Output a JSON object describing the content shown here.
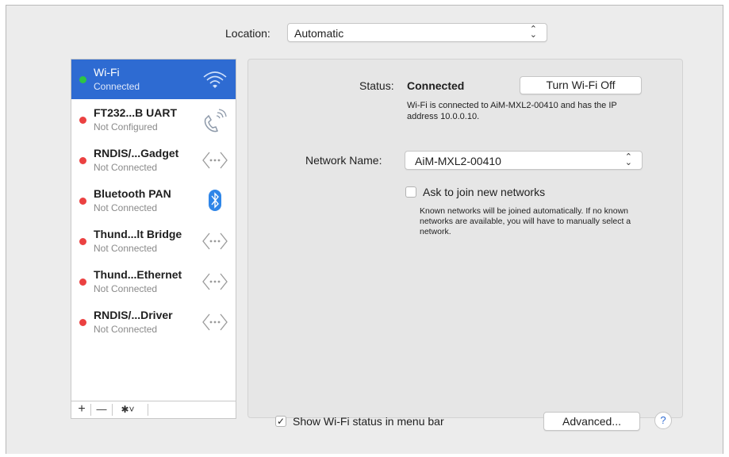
{
  "location": {
    "label": "Location:",
    "value": "Automatic"
  },
  "services": [
    {
      "name": "Wi-Fi",
      "status": "Connected",
      "state": "connected",
      "icon": "wifi-icon",
      "selected": true
    },
    {
      "name": "FT232...B UART",
      "status": "Not Configured",
      "state": "inactive",
      "icon": "phone-icon"
    },
    {
      "name": "RNDIS/...Gadget",
      "status": "Not Connected",
      "state": "inactive",
      "icon": "ethernet-arrows-icon"
    },
    {
      "name": "Bluetooth PAN",
      "status": "Not Connected",
      "state": "inactive",
      "icon": "bluetooth-icon"
    },
    {
      "name": "Thund...lt Bridge",
      "status": "Not Connected",
      "state": "inactive",
      "icon": "ethernet-arrows-icon"
    },
    {
      "name": "Thund...Ethernet",
      "status": "Not Connected",
      "state": "inactive",
      "icon": "ethernet-arrows-icon"
    },
    {
      "name": "RNDIS/...Driver",
      "status": "Not Connected",
      "state": "inactive",
      "icon": "ethernet-arrows-icon"
    }
  ],
  "sidebar_buttons": {
    "add": "+",
    "remove": "—",
    "action": "✱˅"
  },
  "status": {
    "label": "Status:",
    "value": "Connected",
    "toggle_button": "Turn Wi-Fi Off",
    "description": "Wi-Fi is connected to AiM-MXL2-00410 and has the IP address 10.0.0.10."
  },
  "network": {
    "label": "Network Name:",
    "value": "AiM-MXL2-00410"
  },
  "ask_join": {
    "label": "Ask to join new networks",
    "checked": false,
    "description": "Known networks will be joined automatically. If no known networks are available, you will have to manually select a network."
  },
  "show_status": {
    "label": "Show Wi-Fi status in menu bar",
    "checked": true
  },
  "advanced_button": "Advanced...",
  "help_button": "?",
  "colors": {
    "selection": "#2e6bd2",
    "connected": "#2dc544",
    "not_connected": "#eb4141"
  }
}
